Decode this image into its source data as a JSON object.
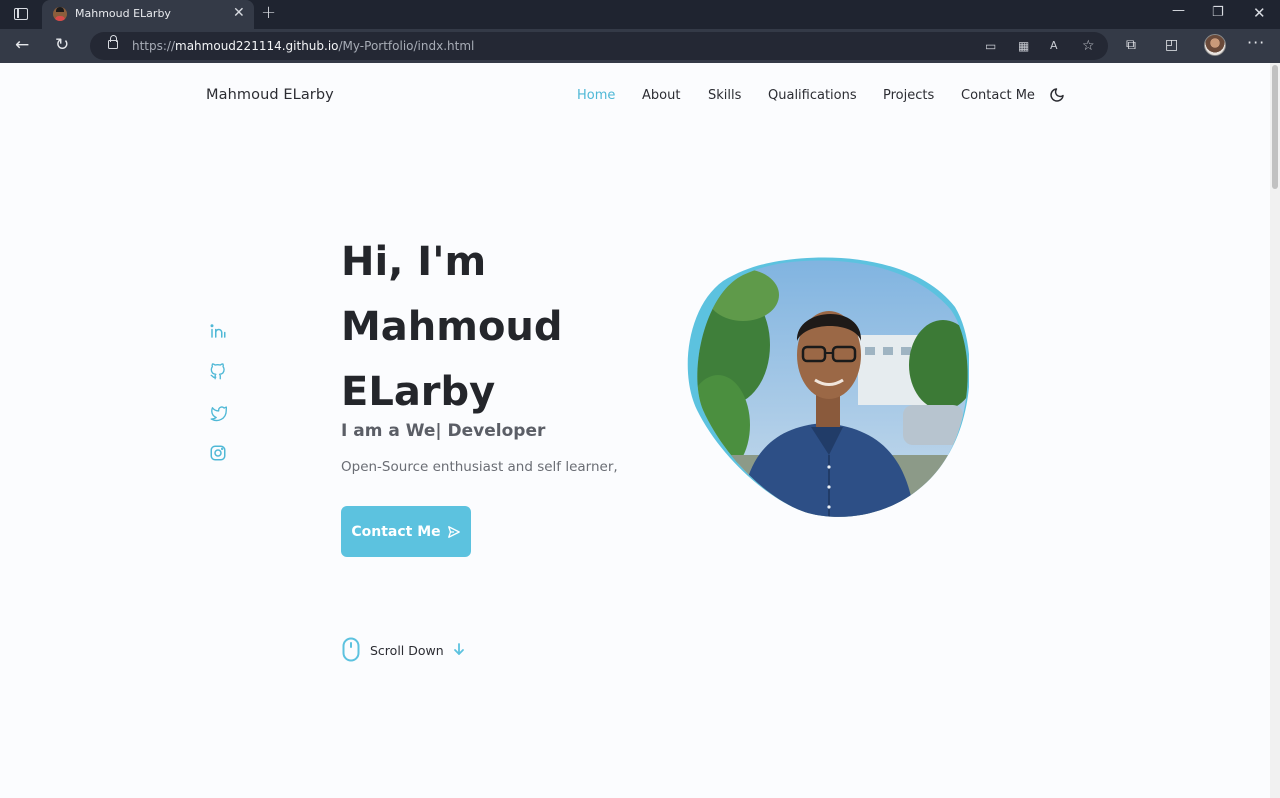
{
  "browser": {
    "tab_title": "Mahmoud ELarby",
    "url_prefix": "https://",
    "url_host": "mahmoud221114.github.io",
    "url_path": "/My-Portfolio/indx.html"
  },
  "nav": {
    "logo": "Mahmoud ELarby",
    "items": [
      {
        "label": "Home",
        "active": true
      },
      {
        "label": "About"
      },
      {
        "label": "Skills"
      },
      {
        "label": "Qualifications"
      },
      {
        "label": "Projects"
      },
      {
        "label": "Contact Me"
      }
    ],
    "theme_toggle_icon": "moon-icon"
  },
  "social": [
    "linkedin-icon",
    "github-icon",
    "twitter-icon",
    "instagram-icon"
  ],
  "hero": {
    "title_line1": "Hi, I'm",
    "title_line2": "Mahmoud",
    "title_line3": "ELarby",
    "subtitle": "I am a We| Developer",
    "description": "Open-Source enthusiast and self learner,",
    "button_label": "Contact Me"
  },
  "scroll": {
    "label": "Scroll Down"
  },
  "colors": {
    "accent": "#5cc2df",
    "text_dark": "#24262b",
    "background": "#fbfcfe"
  }
}
